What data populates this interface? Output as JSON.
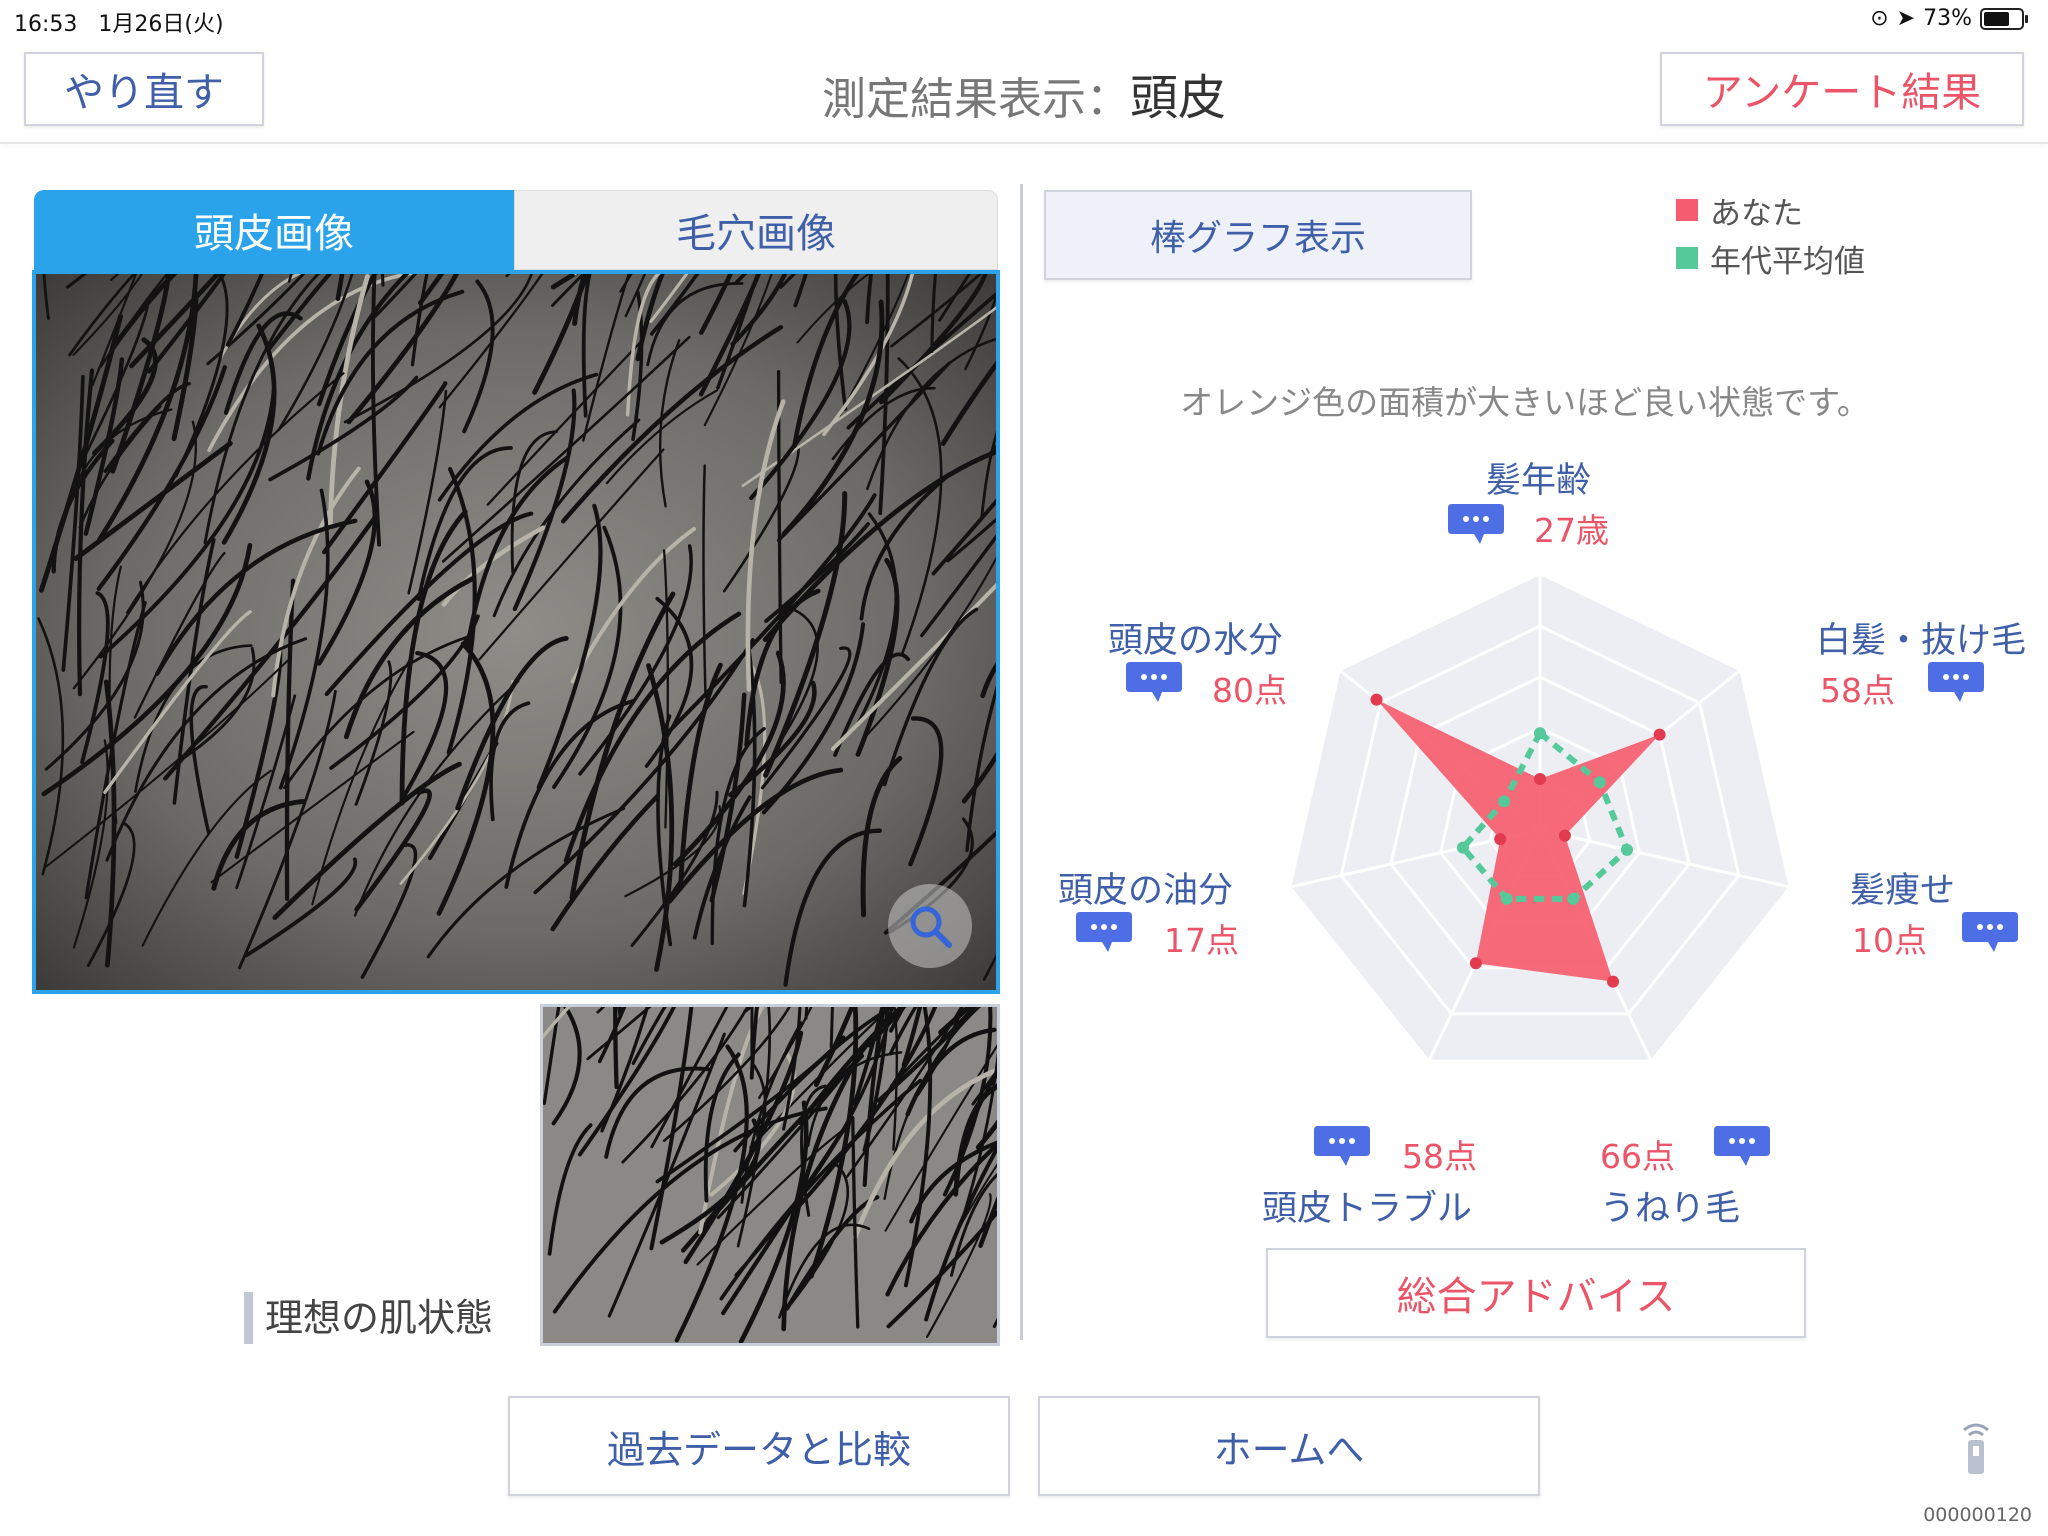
{
  "status_bar": {
    "time": "16:53",
    "date": "1月26日(火)",
    "battery": "73%",
    "battery_level": 0.73
  },
  "header": {
    "back_label": "やり直す",
    "title_prefix": "測定結果表示：",
    "title_main": "頭皮",
    "survey_label": "アンケート結果"
  },
  "tabs": [
    {
      "label": "頭皮画像",
      "active": true
    },
    {
      "label": "毛穴画像",
      "active": false
    }
  ],
  "ideal_label": "理想の肌状態",
  "bar_graph_button": "棒グラフ表示",
  "legend": [
    {
      "label": "あなた",
      "color": "#f55d6e"
    },
    {
      "label": "年代平均値",
      "color": "#55c99a"
    }
  ],
  "note": "オレンジ色の面積が大きいほど良い状態です。",
  "radar": {
    "axes": [
      {
        "name": "髪年齢",
        "value_text": "27歳"
      },
      {
        "name": "白髪・抜け毛",
        "value_text": "58点"
      },
      {
        "name": "髪痩せ",
        "value_text": "10点"
      },
      {
        "name": "うねり毛",
        "value_text": "66点"
      },
      {
        "name": "頭皮トラブル",
        "value_text": "58点"
      },
      {
        "name": "頭皮の油分",
        "value_text": "17点"
      },
      {
        "name": "頭皮の水分",
        "value_text": "80点"
      }
    ],
    "you": [
      0.2,
      0.6,
      0.1,
      0.66,
      0.58,
      0.16,
      0.82
    ],
    "average": [
      0.38,
      0.3,
      0.35,
      0.3,
      0.3,
      0.31,
      0.18
    ]
  },
  "advice_label": "総合アドバイス",
  "compare_label": "過去データと比較",
  "home_label": "ホームへ",
  "device_id": "000000120",
  "colors": {
    "accent_blue": "#2aa3ea",
    "text_blue": "#3f5fa8",
    "accent_red": "#ec5568",
    "you": "#f55d6e",
    "average": "#55c99a"
  }
}
